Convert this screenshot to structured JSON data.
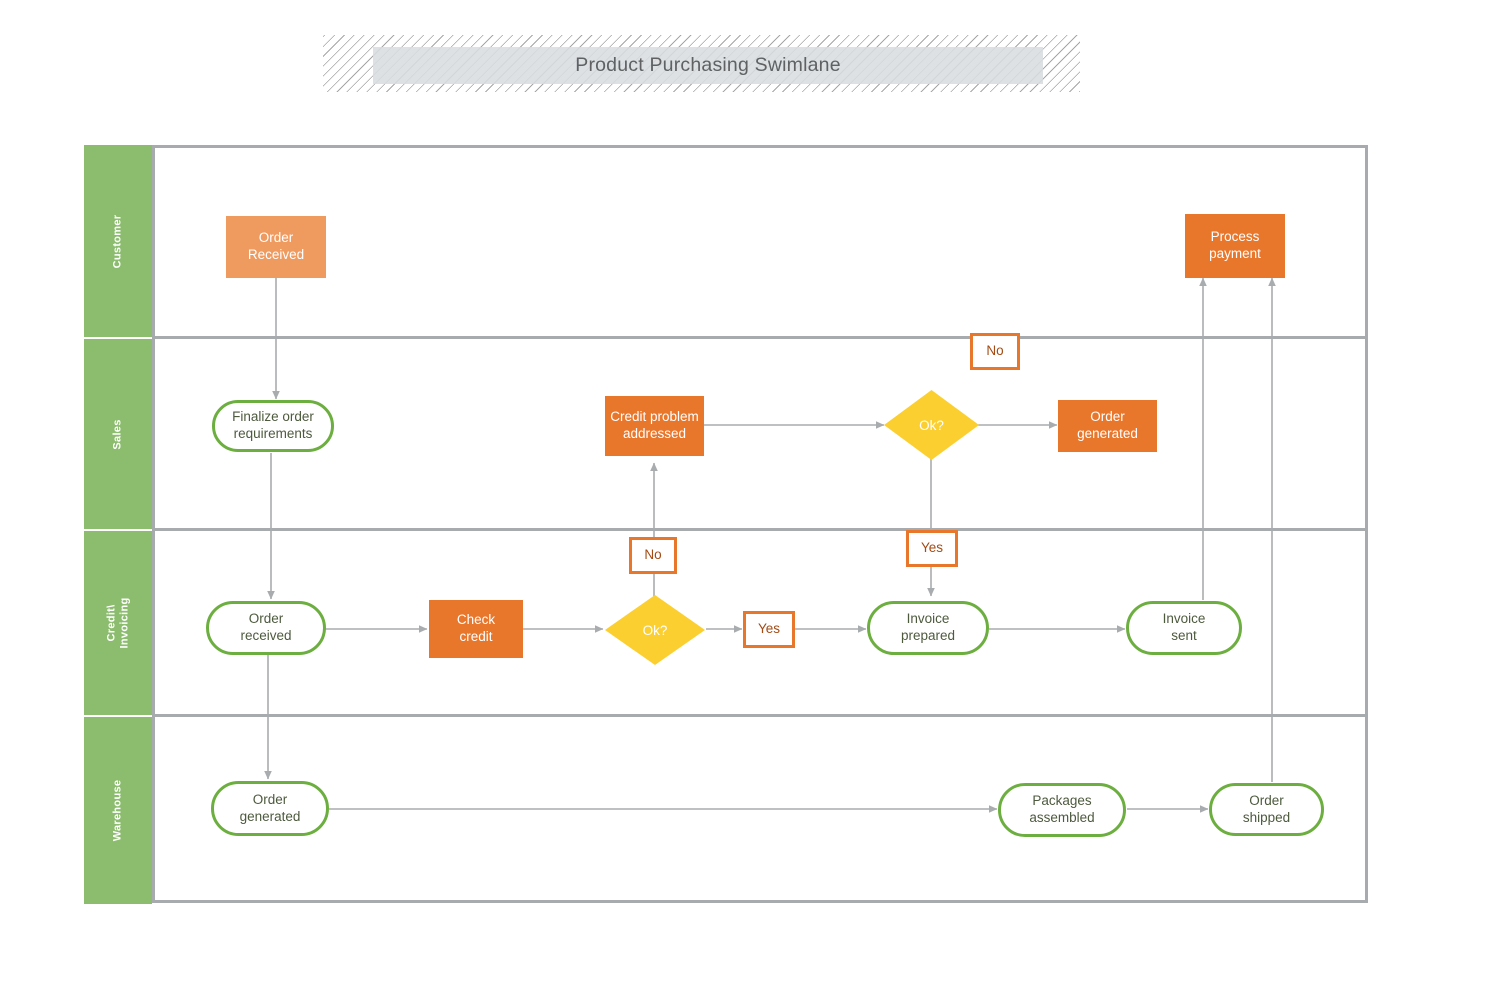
{
  "title": {
    "text": "Product Purchasing Swimlane"
  },
  "colors": {
    "lane_band": "#8cbd6f",
    "frame_border": "#a8abae",
    "process_light": "#ef9a5f",
    "process_dark": "#e8762b",
    "decision": "#fccf30",
    "terminator_border": "#6cae3f",
    "tag_border": "#e8762b",
    "tag_text": "#a24b15",
    "connector": "#a9acae",
    "title_text": "#5f6163",
    "title_fill": "#d8dde0"
  },
  "lanes": [
    {
      "id": "customer",
      "label": "Customer"
    },
    {
      "id": "sales",
      "label": "Sales"
    },
    {
      "id": "credit-invoicing",
      "label": "Credit\\\nInvoicing"
    },
    {
      "id": "warehouse",
      "label": "Warehouse"
    }
  ],
  "nodes": [
    {
      "id": "order-received-customer",
      "lane": "customer",
      "shape": "rect-light",
      "label": "Order\nReceived"
    },
    {
      "id": "process-payment",
      "lane": "customer",
      "shape": "rect-dark",
      "label": "Process\npayment"
    },
    {
      "id": "finalize-order",
      "lane": "sales",
      "shape": "stadium",
      "label": "Finalize order\nrequirements"
    },
    {
      "id": "credit-problem-addressed",
      "lane": "sales",
      "shape": "rect-dark",
      "label": "Credit problem\naddressed"
    },
    {
      "id": "ok-sales",
      "lane": "sales",
      "shape": "diamond",
      "label": "Ok?"
    },
    {
      "id": "order-generated-sales",
      "lane": "sales",
      "shape": "rect-dark",
      "label": "Order\ngenerated"
    },
    {
      "id": "order-received-credit",
      "lane": "credit-invoicing",
      "shape": "stadium",
      "label": "Order\nreceived"
    },
    {
      "id": "check-credit",
      "lane": "credit-invoicing",
      "shape": "rect-dark",
      "label": "Check\ncredit"
    },
    {
      "id": "ok-credit",
      "lane": "credit-invoicing",
      "shape": "diamond",
      "label": "Ok?"
    },
    {
      "id": "invoice-prepared",
      "lane": "credit-invoicing",
      "shape": "stadium",
      "label": "Invoice\nprepared"
    },
    {
      "id": "invoice-sent",
      "lane": "credit-invoicing",
      "shape": "stadium",
      "label": "Invoice\nsent"
    },
    {
      "id": "order-generated-warehouse",
      "lane": "warehouse",
      "shape": "stadium",
      "label": "Order\ngenerated"
    },
    {
      "id": "packages-assembled",
      "lane": "warehouse",
      "shape": "stadium",
      "label": "Packages\nassembled"
    },
    {
      "id": "order-shipped",
      "lane": "warehouse",
      "shape": "stadium",
      "label": "Order\nshipped"
    }
  ],
  "edge_tags": [
    {
      "id": "tag-no-sales",
      "label": "No",
      "from": "ok-sales",
      "to": "process-payment"
    },
    {
      "id": "tag-no-credit",
      "label": "No",
      "from": "ok-credit",
      "to": "credit-problem-addressed"
    },
    {
      "id": "tag-yes-credit",
      "label": "Yes",
      "from": "ok-credit",
      "to": "invoice-prepared"
    },
    {
      "id": "tag-yes-sales",
      "label": "Yes",
      "from": "ok-sales",
      "to": "invoice-prepared"
    }
  ],
  "edges": [
    {
      "from": "order-received-customer",
      "to": "finalize-order"
    },
    {
      "from": "finalize-order",
      "to": "order-received-credit"
    },
    {
      "from": "order-received-credit",
      "to": "check-credit"
    },
    {
      "from": "order-received-credit",
      "to": "order-generated-warehouse"
    },
    {
      "from": "check-credit",
      "to": "ok-credit"
    },
    {
      "from": "ok-credit",
      "to": "credit-problem-addressed",
      "tag": "No"
    },
    {
      "from": "ok-credit",
      "to": "invoice-prepared",
      "tag": "Yes"
    },
    {
      "from": "credit-problem-addressed",
      "to": "ok-sales"
    },
    {
      "from": "ok-sales",
      "to": "order-generated-sales"
    },
    {
      "from": "ok-sales",
      "to": "invoice-prepared",
      "tag": "Yes"
    },
    {
      "from": "invoice-prepared",
      "to": "invoice-sent"
    },
    {
      "from": "invoice-sent",
      "to": "process-payment"
    },
    {
      "from": "order-generated-warehouse",
      "to": "packages-assembled"
    },
    {
      "from": "packages-assembled",
      "to": "order-shipped"
    },
    {
      "from": "order-shipped",
      "to": "process-payment"
    }
  ]
}
